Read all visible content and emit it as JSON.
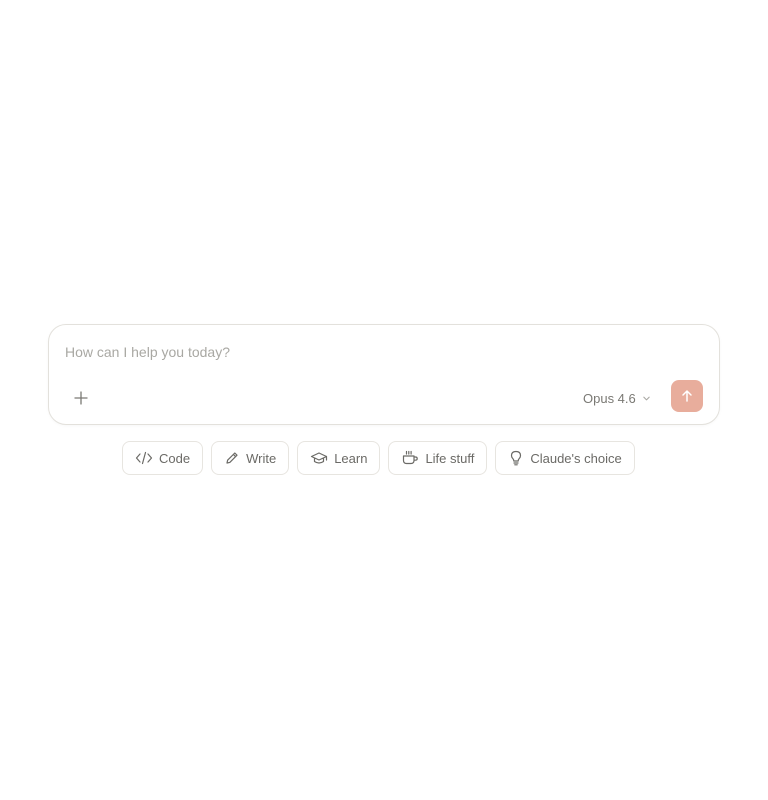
{
  "composer": {
    "placeholder": "How can I help you today?",
    "model_label": "Opus 4.6",
    "icons": {
      "attach": "plus-icon",
      "model_dropdown": "chevron-down-icon",
      "send": "arrow-up-icon"
    },
    "send_color": "#e8ad9c"
  },
  "suggestions": [
    {
      "label": "Code",
      "icon": "code-icon"
    },
    {
      "label": "Write",
      "icon": "pencil-icon"
    },
    {
      "label": "Learn",
      "icon": "graduation-cap-icon"
    },
    {
      "label": "Life stuff",
      "icon": "coffee-cup-icon"
    },
    {
      "label": "Claude's choice",
      "icon": "lightbulb-icon"
    }
  ]
}
